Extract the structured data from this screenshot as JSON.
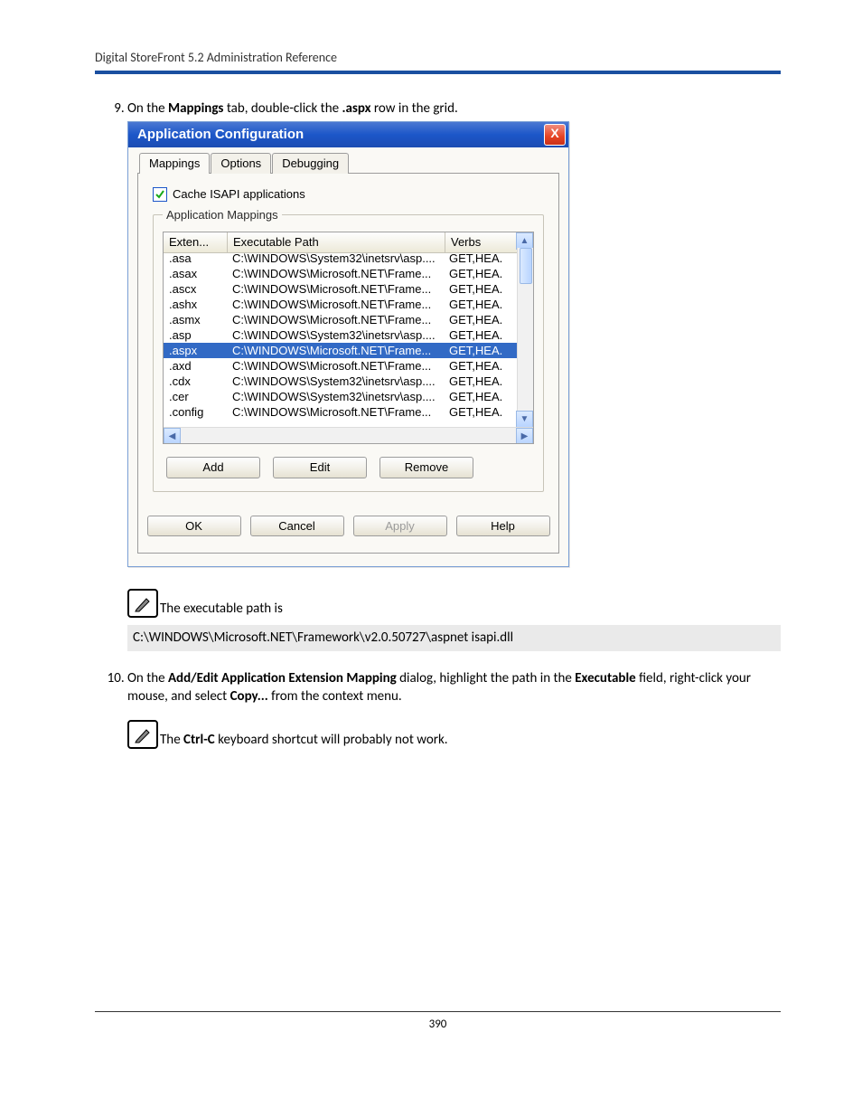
{
  "header": {
    "title": "Digital StoreFront 5.2 Administration Reference"
  },
  "step9": {
    "pre": "On the ",
    "bold1": "Mappings",
    "mid1": " tab, double-click the ",
    "bold2": ".aspx",
    "post": " row in the grid."
  },
  "dialog": {
    "title": "Application Configuration",
    "close": "X",
    "tabs": {
      "t1": "Mappings",
      "t2": "Options",
      "t3": "Debugging"
    },
    "checkbox_label": "Cache ISAPI applications",
    "group_label": "Application Mappings",
    "columns": {
      "ext": "Exten...",
      "path": "Executable Path",
      "verbs": "Verbs"
    },
    "rows": [
      {
        "ext": ".asa",
        "path": "C:\\WINDOWS\\System32\\inetsrv\\asp....",
        "verbs": "GET,HEA."
      },
      {
        "ext": ".asax",
        "path": "C:\\WINDOWS\\Microsoft.NET\\Frame...",
        "verbs": "GET,HEA."
      },
      {
        "ext": ".ascx",
        "path": "C:\\WINDOWS\\Microsoft.NET\\Frame...",
        "verbs": "GET,HEA."
      },
      {
        "ext": ".ashx",
        "path": "C:\\WINDOWS\\Microsoft.NET\\Frame...",
        "verbs": "GET,HEA."
      },
      {
        "ext": ".asmx",
        "path": "C:\\WINDOWS\\Microsoft.NET\\Frame...",
        "verbs": "GET,HEA."
      },
      {
        "ext": ".asp",
        "path": "C:\\WINDOWS\\System32\\inetsrv\\asp....",
        "verbs": "GET,HEA."
      },
      {
        "ext": ".aspx",
        "path": "C:\\WINDOWS\\Microsoft.NET\\Frame...",
        "verbs": "GET,HEA.",
        "sel": true
      },
      {
        "ext": ".axd",
        "path": "C:\\WINDOWS\\Microsoft.NET\\Frame...",
        "verbs": "GET,HEA."
      },
      {
        "ext": ".cdx",
        "path": "C:\\WINDOWS\\System32\\inetsrv\\asp....",
        "verbs": "GET,HEA."
      },
      {
        "ext": ".cer",
        "path": "C:\\WINDOWS\\System32\\inetsrv\\asp....",
        "verbs": "GET,HEA."
      },
      {
        "ext": ".config",
        "path": "C:\\WINDOWS\\Microsoft.NET\\Frame...",
        "verbs": "GET,HEA."
      }
    ],
    "buttons": {
      "add": "Add",
      "edit": "Edit",
      "remove": "Remove"
    },
    "bottom": {
      "ok": "OK",
      "cancel": "Cancel",
      "apply": "Apply",
      "help": "Help"
    }
  },
  "note1": {
    "text": "The executable path is",
    "path": "C:\\WINDOWS\\Microsoft.NET\\Framework\\v2.0.50727\\aspnet isapi.dll"
  },
  "step10": {
    "pre": "On the ",
    "bold1": "Add/Edit Application Extension Mapping",
    "mid1": " dialog, highlight the path in the ",
    "bold2": "Executable",
    "mid2": " field, right-click your mouse, and select ",
    "bold3": "Copy...",
    "post": " from the context menu."
  },
  "note2": {
    "pre": "The ",
    "bold": "Ctrl-C",
    "post": " keyboard shortcut will probably not work."
  },
  "footer": {
    "page": "390"
  }
}
